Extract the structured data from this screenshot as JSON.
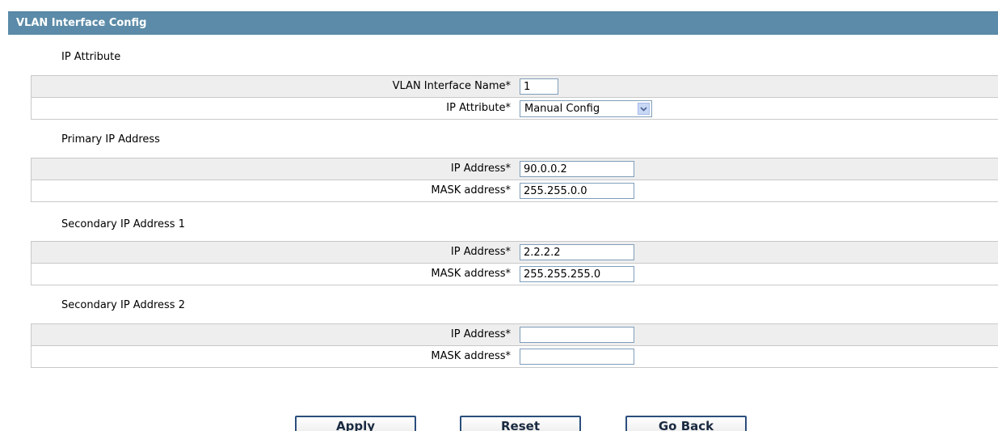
{
  "header": {
    "title": "VLAN Interface Config"
  },
  "sections": [
    {
      "title": "IP Attribute",
      "fields": [
        {
          "label": "VLAN Interface Name*",
          "value": "1"
        },
        {
          "label": "IP Attribute*",
          "value": "Manual Config"
        }
      ]
    },
    {
      "title": "Primary IP Address",
      "fields": [
        {
          "label": "IP Address*",
          "value": "90.0.0.2"
        },
        {
          "label": "MASK address*",
          "value": "255.255.0.0"
        }
      ]
    },
    {
      "title": "Secondary IP Address 1",
      "fields": [
        {
          "label": "IP Address*",
          "value": "2.2.2.2"
        },
        {
          "label": "MASK address*",
          "value": "255.255.255.0"
        }
      ]
    },
    {
      "title": "Secondary IP Address 2",
      "fields": [
        {
          "label": "IP Address*",
          "value": ""
        },
        {
          "label": "MASK address*",
          "value": ""
        }
      ]
    }
  ],
  "buttons": {
    "apply": "Apply",
    "reset": "Reset",
    "go_back": "Go Back"
  },
  "colors": {
    "header_bg": "#5b8ba8",
    "row_shaded": "#eeeeee",
    "input_border": "#7f9db9",
    "button_border": "#2b4e7c"
  },
  "icons": {
    "select_arrow": "chevron-down-icon"
  }
}
